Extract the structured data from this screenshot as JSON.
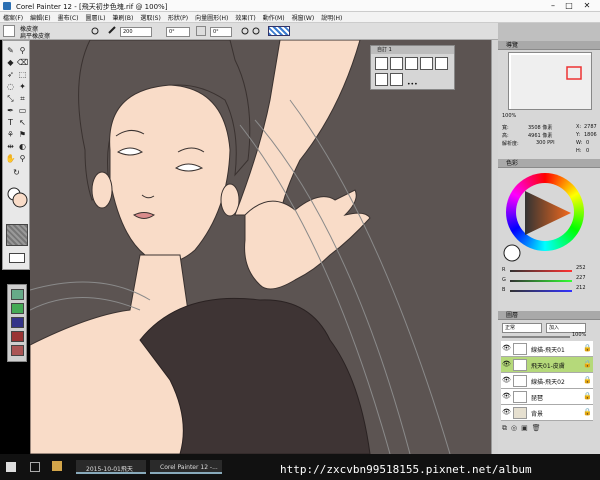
{
  "window": {
    "title": "Corel Painter 12 - [飛天初步色塊.rif @ 100%]",
    "minimize": "–",
    "maximize": "□",
    "close": "✕"
  },
  "menu": [
    "檔案(F)",
    "編輯(E)",
    "畫布(C)",
    "圖層(L)",
    "筆刷(B)",
    "選取(S)",
    "形狀(P)",
    "向量圖形(H)",
    "效果(T)",
    "動作(M)",
    "視窗(W)",
    "說明(H)"
  ],
  "propbar": {
    "brush_category": "橡皮擦",
    "brush_variant": "扁平橡皮擦",
    "size": "200",
    "opacity": "0°",
    "angle": "0°"
  },
  "brush_panel": {
    "title": "自訂 1",
    "more": "•••"
  },
  "panels": {
    "navigator": {
      "title": "導覽",
      "zoom": "100%",
      "width_label": "寬:",
      "width_value": "3508 像素",
      "height_label": "高:",
      "height_value": "4961 像素",
      "res_label": "解析度:",
      "res_value": "300 PPI",
      "x_label": "X:",
      "x_value": "2787",
      "y_label": "Y:",
      "y_value": "1806",
      "w_label": "W:",
      "w_value": "0",
      "h_label": "H:",
      "h_value": "0"
    },
    "color": {
      "title": "色彩",
      "r_label": "R",
      "r_value": "252",
      "g_label": "G",
      "g_value": "227",
      "b_label": "B",
      "b_value": "212"
    },
    "layers": {
      "title": "圖層",
      "blend_mode": "正常",
      "composite": "加入",
      "opacity": "100%"
    }
  },
  "layers": [
    {
      "name": "線描-飛天01",
      "selected": false,
      "color": "#ffffff"
    },
    {
      "name": "飛天01-皮膚",
      "selected": true,
      "color": "#b5d97a"
    },
    {
      "name": "線描-飛天02",
      "selected": false,
      "color": "#ffffff"
    },
    {
      "name": "琵琶",
      "selected": false,
      "color": "#ffffff"
    },
    {
      "name": "背景",
      "selected": false,
      "color": "#ffffff"
    }
  ],
  "taskbar": {
    "item1": "2015-10-01飛天",
    "item2": "Corel Painter 12 -..."
  },
  "watermark": "http://zxcvbn99518155.pixnet.net/album",
  "colors": {
    "skin": "#f9dcc8",
    "bg": "#5c5452",
    "hair": "#3e3434",
    "accent": "#b5d97a"
  }
}
